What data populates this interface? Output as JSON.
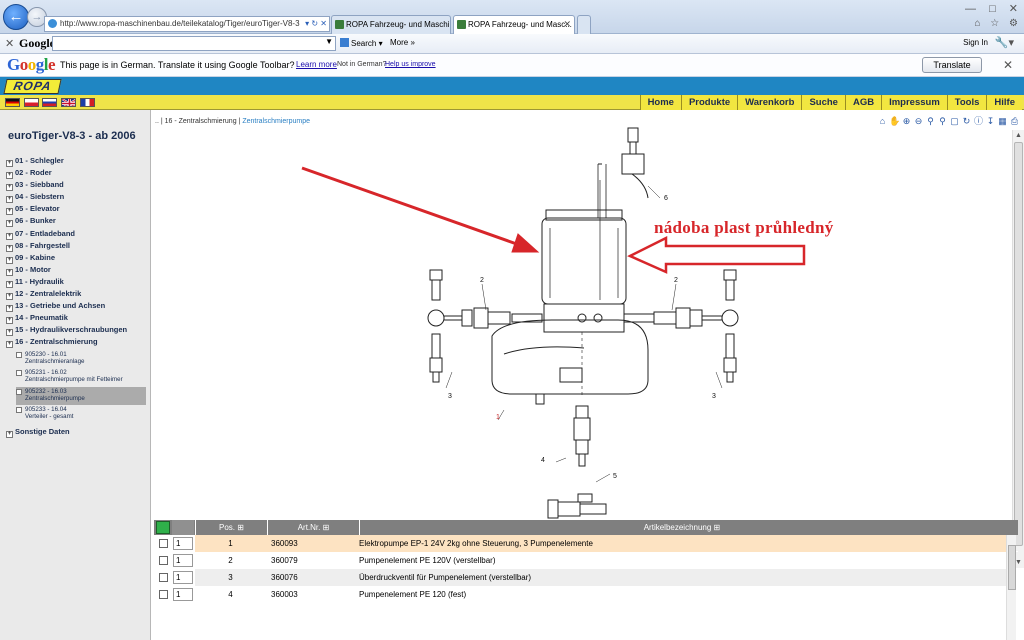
{
  "browser": {
    "url": "http://www.ropa-maschinenbau.de/teilekatalog/Tiger/euroTiger-V8-3",
    "tabs": [
      {
        "label": "ROPA Fahrzeug- und Maschin..."
      },
      {
        "label": "ROPA Fahrzeug- und Masc..."
      }
    ]
  },
  "google_toolbar": {
    "logo": "Google",
    "search_label": "Search",
    "more_label": "More",
    "signin_label": "Sign In"
  },
  "translate_bar": {
    "logo": "Google",
    "message": "This page is in German.  Translate it using Google Toolbar?",
    "learn_more": "Learn more",
    "not_german": "Not in German?",
    "help_improve": "Help us improve",
    "translate_button": "Translate"
  },
  "site": {
    "logo": "ROPA",
    "menu": [
      "Home",
      "Produkte",
      "Warenkorb",
      "Suche",
      "AGB",
      "Impressum",
      "Tools",
      "Hilfe"
    ]
  },
  "sidebar": {
    "title": "euroTiger-V8-3 - ab 2006",
    "items": [
      "01 - Schlegler",
      "02 - Roder",
      "03 - Siebband",
      "04 - Siebstern",
      "05 - Elevator",
      "06 - Bunker",
      "07 - Entladeband",
      "08 - Fahrgestell",
      "09 - Kabine",
      "10 - Motor",
      "11 - Hydraulik",
      "12 - Zentralelektrik",
      "13 - Getriebe und Achsen",
      "14 - Pneumatik",
      "15 - Hydraulikverschraubungen",
      "16 - Zentralschmierung"
    ],
    "subitems": [
      {
        "code": "905230 - 16.01",
        "name": "Zentralschmieranlage"
      },
      {
        "code": "905231 - 16.02",
        "name": "Zentralschmierpumpe mit Fetteimer"
      },
      {
        "code": "905232 - 16.03",
        "name": "Zentralschmierpumpe"
      },
      {
        "code": "905233 - 16.04",
        "name": "Verteiler - gesamt"
      }
    ],
    "other": "Sonstige Daten"
  },
  "breadcrumb": {
    "root": "..",
    "parent": "16 - Zentralschmierung",
    "current": "Zentralschmierpumpe"
  },
  "diagram": {
    "annotation": "nádoba plast průhledný",
    "part_labels": [
      "1",
      "2",
      "2",
      "3",
      "3",
      "4",
      "5",
      "6"
    ]
  },
  "table": {
    "headers": {
      "pos": "Pos.",
      "art": "Art.Nr.",
      "desc": "Artikelbezeichnung"
    },
    "rows": [
      {
        "qty": "1",
        "pos": "1",
        "art": "360093",
        "desc": "Elektropumpe EP-1 24V 2kg ohne Steuerung, 3 Pumpenelemente"
      },
      {
        "qty": "1",
        "pos": "2",
        "art": "360079",
        "desc": "Pumpenelement PE 120V (verstellbar)"
      },
      {
        "qty": "1",
        "pos": "3",
        "art": "360076",
        "desc": "Überdruckventil für Pumpenelement (verstellbar)"
      },
      {
        "qty": "1",
        "pos": "4",
        "art": "360003",
        "desc": "Pumpenelement PE 120 (fest)"
      }
    ]
  },
  "colors": {
    "menu_bar": "#efe449",
    "logo_bar": "#1f86c3",
    "annotation": "#d7262a",
    "highlight_row": "#fde3c2"
  }
}
